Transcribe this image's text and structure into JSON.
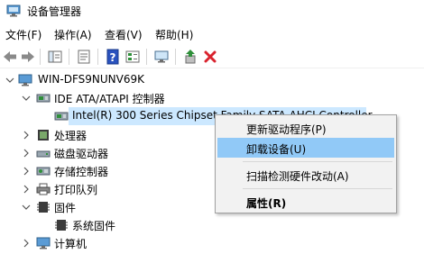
{
  "window": {
    "title": "设备管理器",
    "app_icon": "device-manager-icon"
  },
  "menu": [
    {
      "label": "文件(F)"
    },
    {
      "label": "操作(A)"
    },
    {
      "label": "查看(V)"
    },
    {
      "label": "帮助(H)"
    }
  ],
  "toolbar": {
    "buttons": [
      "back-arrow-icon",
      "forward-arrow-icon",
      "show-hide-tree-icon",
      "properties-icon",
      "help-icon",
      "view-icon",
      "monitor-icon",
      "update-driver-icon",
      "uninstall-x-icon"
    ]
  },
  "tree": {
    "root": "WIN-DFS9NUNV69K",
    "ide_category": "IDE ATA/ATAPI 控制器",
    "ide_device": "Intel(R) 300 Series Chipset Family SATA AHCI Controller",
    "processor": "处理器",
    "disk": "磁盘驱动器",
    "storage": "存储控制器",
    "print_queue": "打印队列",
    "firmware": "固件",
    "system_firmware": "系统固件",
    "computer": "计算机"
  },
  "context_menu": {
    "update_driver": "更新驱动程序(P)",
    "uninstall_device": "卸载设备(U)",
    "scan_hardware": "扫描检测硬件改动(A)",
    "properties": "属性(R)"
  },
  "colors": {
    "selection": "#cce8ff",
    "menu_hover": "#91c9f7",
    "menu_bg": "#f2f2f2",
    "uninstall_red": "#d9232e",
    "update_green": "#2f8f3a"
  }
}
